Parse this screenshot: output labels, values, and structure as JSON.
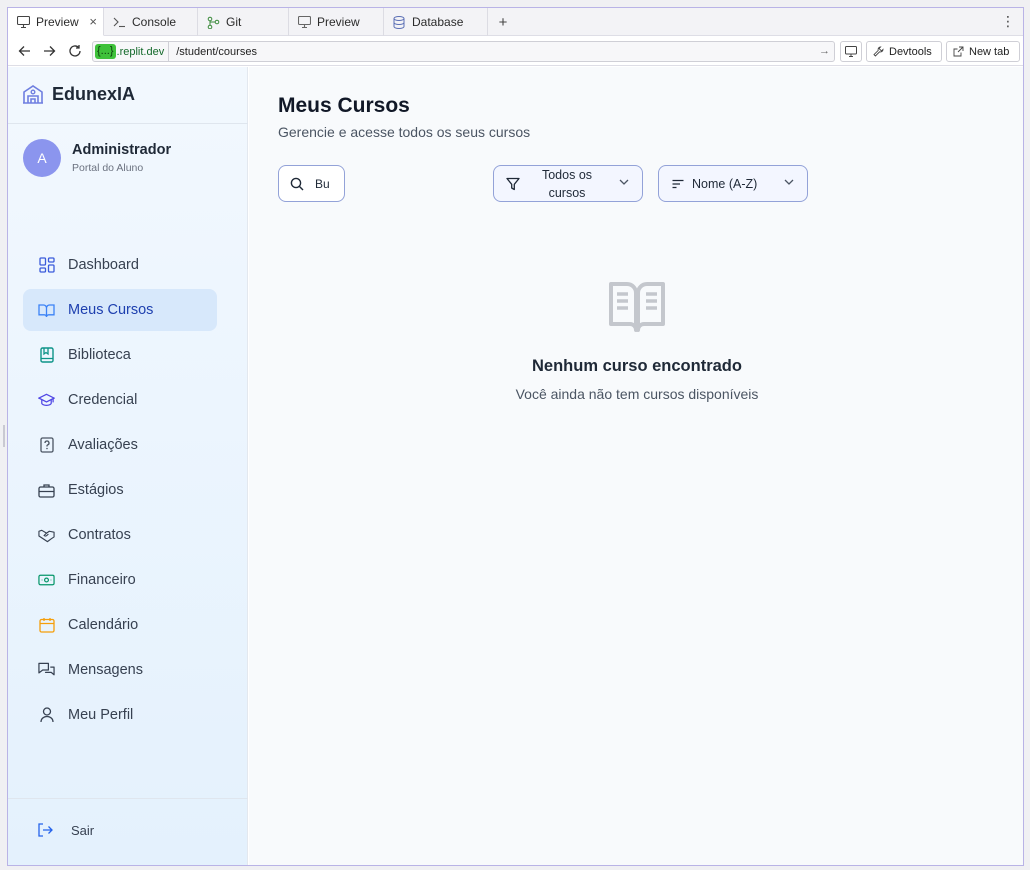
{
  "browser": {
    "tabs": [
      {
        "label": "Preview",
        "icon": "monitor-icon",
        "active": true
      },
      {
        "label": "Console",
        "icon": "terminal-icon"
      },
      {
        "label": "Git",
        "icon": "git-branch-icon"
      },
      {
        "label": "Preview",
        "icon": "monitor-icon"
      },
      {
        "label": "Database",
        "icon": "database-icon"
      }
    ],
    "close_glyph": "×",
    "add_glyph": "+",
    "url_badge": "{...}",
    "url_host": ".replit.dev",
    "url_path": "/student/courses",
    "devtools_label": "Devtools",
    "newtab_label": "New tab"
  },
  "sidebar": {
    "brand": "EdunexIA",
    "user": {
      "initial": "A",
      "name": "Administrador",
      "role": "Portal do Aluno"
    },
    "items": [
      {
        "label": "Dashboard",
        "icon": "dashboard-icon"
      },
      {
        "label": "Meus Cursos",
        "icon": "book-open-icon",
        "active": true
      },
      {
        "label": "Biblioteca",
        "icon": "library-icon"
      },
      {
        "label": "Credencial",
        "icon": "graduation-cap-icon"
      },
      {
        "label": "Avaliações",
        "icon": "file-question-icon"
      },
      {
        "label": "Estágios",
        "icon": "briefcase-icon"
      },
      {
        "label": "Contratos",
        "icon": "handshake-icon"
      },
      {
        "label": "Financeiro",
        "icon": "banknote-icon"
      },
      {
        "label": "Calendário",
        "icon": "calendar-icon"
      },
      {
        "label": "Mensagens",
        "icon": "messages-icon"
      },
      {
        "label": "Meu Perfil",
        "icon": "user-icon"
      }
    ],
    "logout": "Sair"
  },
  "main": {
    "title": "Meus Cursos",
    "subtitle": "Gerencie e acesse todos os seus cursos",
    "search_value": "Bu",
    "filter_label": "Todos os cursos",
    "sort_label": "Nome (A-Z)",
    "empty_title": "Nenhum curso encontrado",
    "empty_subtitle": "Você ainda não tem cursos disponíveis"
  },
  "colors": {
    "accent": "#1e40af",
    "active_bg": "#d7e8fb",
    "avatar": "#8b95ee",
    "url_badge": "#3ec13a"
  }
}
